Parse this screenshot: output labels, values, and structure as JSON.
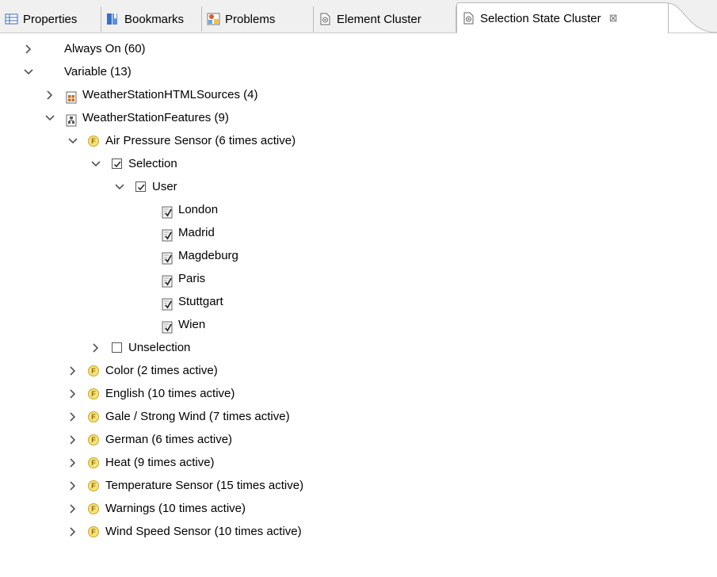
{
  "tabs": [
    {
      "label": "Properties",
      "icon": "properties-icon"
    },
    {
      "label": "Bookmarks",
      "icon": "bookmarks-icon"
    },
    {
      "label": "Problems",
      "icon": "problems-icon"
    },
    {
      "label": "Element Cluster",
      "icon": "cluster-icon"
    },
    {
      "label": "Selection State Cluster",
      "icon": "cluster-icon",
      "active": true,
      "close": "⊠"
    }
  ],
  "tree": {
    "always_on": "Always On (60)",
    "variable": "Variable (13)",
    "html_sources": "WeatherStationHTMLSources (4)",
    "features": "WeatherStationFeatures (9)",
    "air_pressure": "Air Pressure Sensor (6 times active)",
    "selection": "Selection",
    "user": "User",
    "cities": [
      "London",
      "Madrid",
      "Magdeburg",
      "Paris",
      "Stuttgart",
      "Wien"
    ],
    "unselection": "Unselection",
    "other_features": [
      "Color (2 times active)",
      "English (10 times active)",
      "Gale / Strong Wind (7 times active)",
      "German (6 times active)",
      "Heat (9 times active)",
      "Temperature Sensor (15 times active)",
      "Warnings (10 times active)",
      "Wind Speed Sensor (10 times active)"
    ],
    "feature_badge": "F"
  },
  "colors": {
    "feature_fill": "#f7e27c",
    "feature_border": "#c9a81f",
    "tab_bar": "#f0f0f0",
    "twistie": "#555555"
  }
}
